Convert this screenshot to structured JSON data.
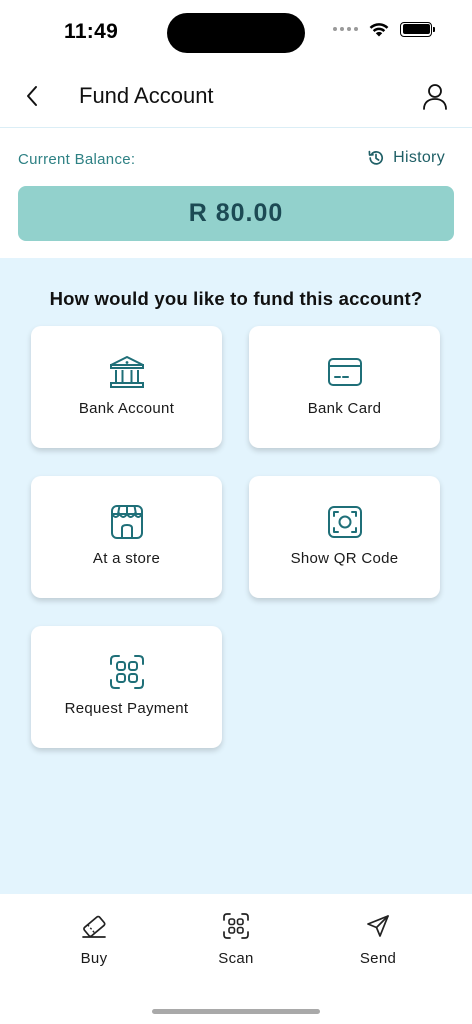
{
  "status_bar": {
    "time": "11:49"
  },
  "header": {
    "title": "Fund Account",
    "back_icon": "chevron-left-icon",
    "profile_icon": "user-icon"
  },
  "balance": {
    "label": "Current Balance:",
    "history_label": "History",
    "amount": "R 80.00"
  },
  "options": {
    "question": "How would you like to fund this account?",
    "items": [
      {
        "label": "Bank Account",
        "icon": "bank-icon"
      },
      {
        "label": "Bank Card",
        "icon": "card-icon"
      },
      {
        "label": "At a store",
        "icon": "store-icon"
      },
      {
        "label": "Show QR Code",
        "icon": "qr-code-icon"
      },
      {
        "label": "Request Payment",
        "icon": "scan-grid-icon"
      }
    ]
  },
  "bottom_nav": {
    "tabs": [
      {
        "label": "Buy",
        "icon": "voucher-icon"
      },
      {
        "label": "Scan",
        "icon": "scan-icon"
      },
      {
        "label": "Send",
        "icon": "send-icon"
      }
    ]
  },
  "colors": {
    "accent": "#1f6f78",
    "balance_bg": "#92d1cc",
    "options_bg": "#e3f4fd",
    "balance_label": "#2e8184"
  }
}
